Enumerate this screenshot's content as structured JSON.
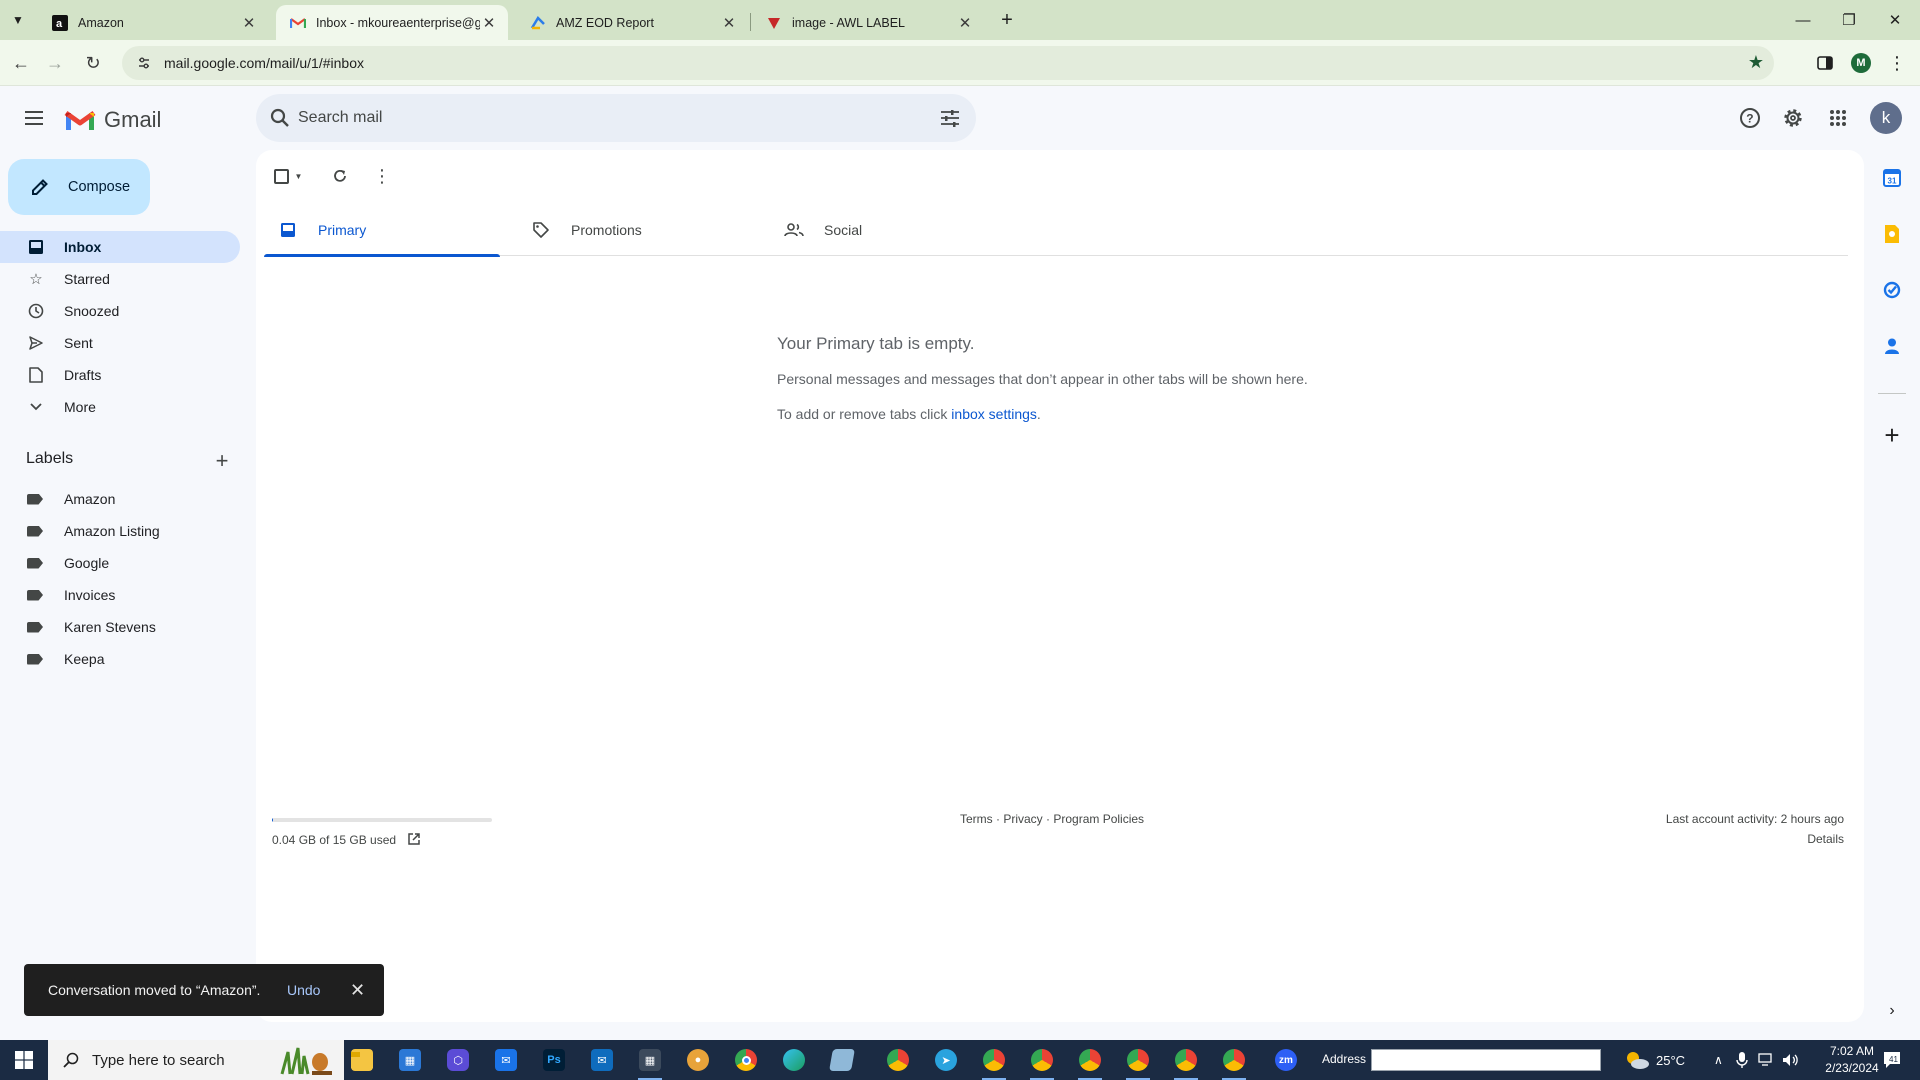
{
  "browser": {
    "tabs": [
      {
        "title": "Amazon",
        "icon": "amazon-favicon"
      },
      {
        "title": "Inbox - mkoureaenterprise@gm",
        "icon": "gmail-favicon",
        "active": true
      },
      {
        "title": "AMZ EOD Report",
        "icon": "sheets-favicon"
      },
      {
        "title": "image - AWL LABEL",
        "icon": "red-favicon"
      }
    ],
    "url": "mail.google.com/mail/u/1/#inbox",
    "profile_initial": "M"
  },
  "gmail": {
    "wordmark": "Gmail",
    "search_placeholder": "Search mail",
    "account_initial": "k",
    "compose_label": "Compose",
    "nav": [
      {
        "label": "Inbox",
        "icon": "inbox-icon",
        "active": true
      },
      {
        "label": "Starred",
        "icon": "star-icon"
      },
      {
        "label": "Snoozed",
        "icon": "clock-icon"
      },
      {
        "label": "Sent",
        "icon": "send-icon"
      },
      {
        "label": "Drafts",
        "icon": "draft-icon"
      },
      {
        "label": "More",
        "icon": "chevron-down-icon"
      }
    ],
    "labels_title": "Labels",
    "labels": [
      "Amazon",
      "Amazon Listing",
      "Google",
      "Invoices",
      "Karen Stevens",
      "Keepa"
    ],
    "tabs": [
      {
        "label": "Primary",
        "icon": "inbox-tab-icon",
        "active": true
      },
      {
        "label": "Promotions",
        "icon": "tag-icon"
      },
      {
        "label": "Social",
        "icon": "people-icon"
      }
    ],
    "empty": {
      "title": "Your Primary tab is empty.",
      "line1": "Personal messages and messages that don’t appear in other tabs will be shown here.",
      "line2_prefix": "To add or remove tabs click ",
      "line2_link": "inbox settings",
      "line2_suffix": "."
    },
    "footer": {
      "storage_text": "0.04 GB of 15 GB used",
      "storage_fraction": 0.003,
      "terms": "Terms",
      "privacy": "Privacy",
      "policies": "Program Policies",
      "sep": " · ",
      "last_activity": "Last account activity: 2 hours ago",
      "details": "Details"
    },
    "snackbar": {
      "message": "Conversation moved to “Amazon”.",
      "undo": "Undo"
    }
  },
  "taskbar": {
    "search_placeholder": "Type here to search",
    "address_label": "Address",
    "weather": "25°C",
    "time": "7:02 AM",
    "date": "2/23/2024",
    "notif_count": "41"
  },
  "colors": {
    "accent": "#0b57d0",
    "compose_bg": "#c2e7ff",
    "active_nav_bg": "#d3e3fd",
    "chrome_tabstrip": "#d3e3c8"
  }
}
